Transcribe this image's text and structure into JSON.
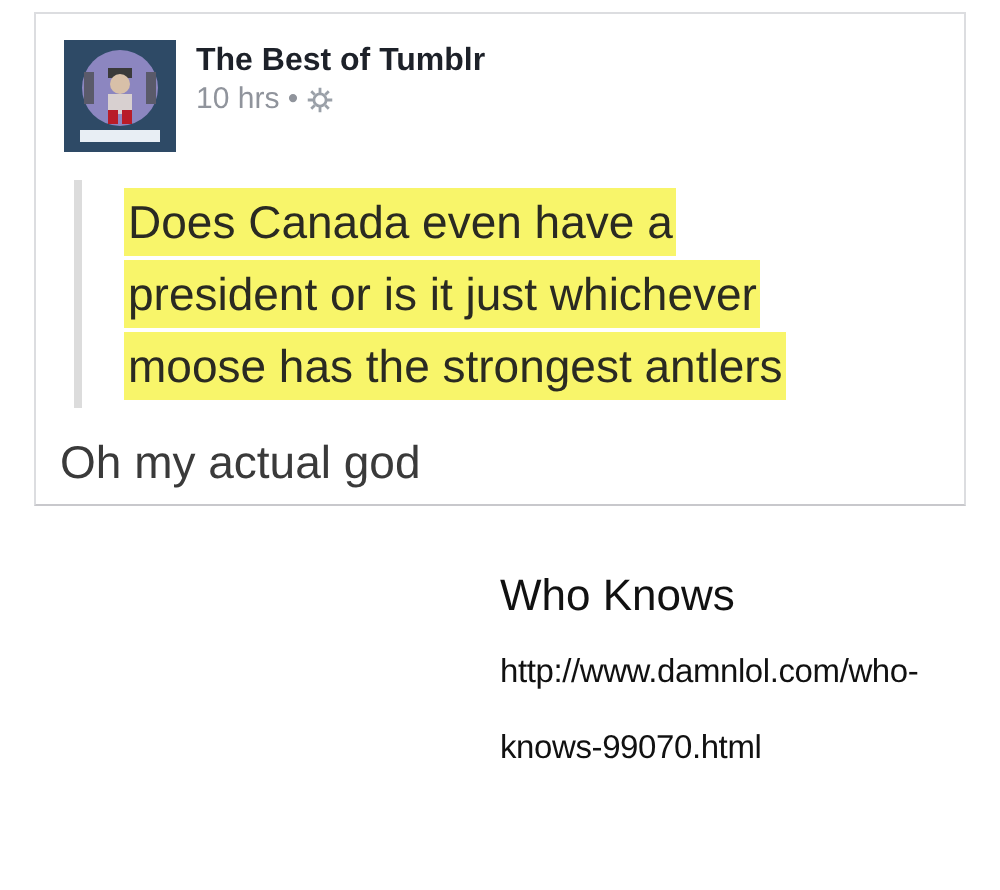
{
  "post": {
    "author": "The Best of Tumblr",
    "time": "10 hrs •",
    "quote_lines": [
      "Does Canada even have a",
      "president or is it just whichever",
      "moose has the strongest antlers"
    ],
    "comment": "Oh my actual god"
  },
  "caption": {
    "title": "Who Knows",
    "url": "http://www.damnlol.com/who-knows-99070.html"
  }
}
